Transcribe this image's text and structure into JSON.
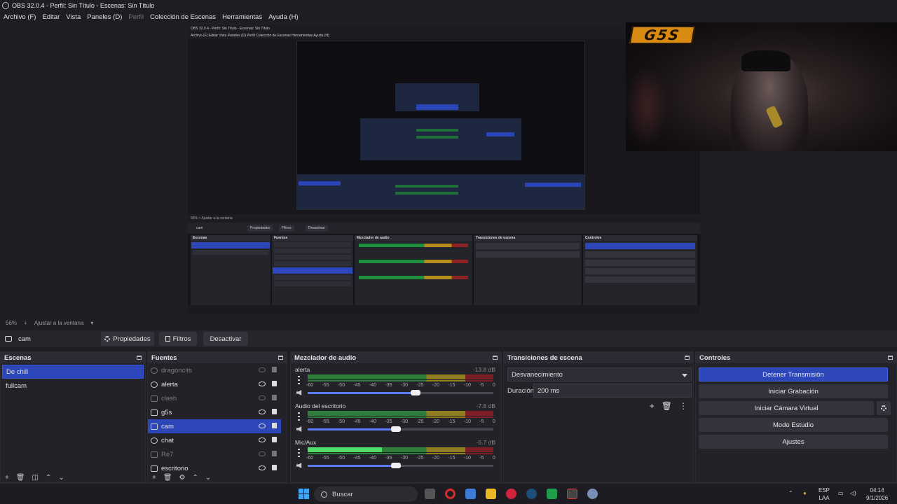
{
  "window": {
    "title": "OBS 32.0.4 - Perfil: Sin Título - Escenas: Sin Título"
  },
  "menu": [
    {
      "label": "Archivo (F)",
      "enabled": true
    },
    {
      "label": "Editar",
      "enabled": true
    },
    {
      "label": "Vista",
      "enabled": true
    },
    {
      "label": "Paneles (D)",
      "enabled": true
    },
    {
      "label": "Perfil",
      "enabled": false
    },
    {
      "label": "Colección de Escenas",
      "enabled": true
    },
    {
      "label": "Herramientas",
      "enabled": true
    },
    {
      "label": "Ayuda (H)",
      "enabled": true
    }
  ],
  "preview": {
    "logo_text": "G5S",
    "nested": {
      "title": "OBS 32.0.4 - Perfil: Sin Título - Escenas: Sin Título",
      "menu": "Archivo (F)   Editar   Vista   Paneles (D)   Perfil   Colección de Escenas   Herramientas   Ayuda (H)",
      "zoom": "56%   +   Ajustar a la ventana",
      "toolbar": {
        "source": "cam",
        "props": "Propiedades",
        "filters": "Filtros",
        "deactivate": "Desactivar"
      },
      "docks": [
        "Escenas",
        "Fuentes",
        "Mezclador de audio",
        "Transiciones de escena",
        "Controles"
      ]
    }
  },
  "zoom": {
    "level": "56%",
    "plus": "+",
    "fit": "Ajustar a la ventana"
  },
  "source_toolbar": {
    "source_name": "cam",
    "properties": "Propiedades",
    "filters": "Filtros",
    "deactivate": "Desactivar"
  },
  "scenes": {
    "title": "Escenas",
    "items": [
      {
        "name": "De chill",
        "selected": true
      },
      {
        "name": "fullcam",
        "selected": false
      }
    ]
  },
  "sources": {
    "title": "Fuentes",
    "items": [
      {
        "name": "dragoncits",
        "visible": false,
        "icon": "globe-icon"
      },
      {
        "name": "alerta",
        "visible": true,
        "icon": "globe-icon"
      },
      {
        "name": "clash",
        "visible": false,
        "icon": "window-icon"
      },
      {
        "name": "g5s",
        "visible": true,
        "icon": "image-icon"
      },
      {
        "name": "cam",
        "visible": true,
        "selected": true,
        "icon": "camera-icon"
      },
      {
        "name": "chat",
        "visible": true,
        "icon": "globe-icon"
      },
      {
        "name": "Re7",
        "visible": false,
        "icon": "gamepad-icon"
      },
      {
        "name": "escritorio",
        "visible": true,
        "icon": "monitor-icon"
      }
    ]
  },
  "mixer": {
    "title": "Mezclador de audio",
    "ticks": [
      "-60",
      "-55",
      "-50",
      "-45",
      "-40",
      "-35",
      "-30",
      "-25",
      "-20",
      "-15",
      "-10",
      "-5",
      "0"
    ],
    "channels": [
      {
        "name": "alerta",
        "db": "-13.8 dB",
        "level": 0.0,
        "volume": 0.97
      },
      {
        "name": "Audio del escritorio",
        "db": "-7.8 dB",
        "level": 0.0,
        "volume": 0.79
      },
      {
        "name": "Mic/Aux",
        "db": "-5.7 dB",
        "level": 0.4,
        "volume": 0.79
      }
    ]
  },
  "transitions": {
    "title": "Transiciones de escena",
    "selected": "Desvanecimiento",
    "duration_label": "Duración",
    "duration_value": "200 ms"
  },
  "controls": {
    "title": "Controles",
    "buttons": {
      "stream": "Detener Transmisión",
      "record": "Iniciar Grabación",
      "virtualcam": "Iniciar Cámara Virtual",
      "studio": "Modo Estudio",
      "settings": "Ajustes"
    }
  },
  "taskbar": {
    "search_placeholder": "Buscar",
    "lang_top": "ESP",
    "lang_bottom": "LAA",
    "time": "04:14",
    "date": "9/1/2026"
  },
  "colors": {
    "accent": "#2d46b9",
    "bg": "#1f1f23",
    "panel": "#222228"
  }
}
